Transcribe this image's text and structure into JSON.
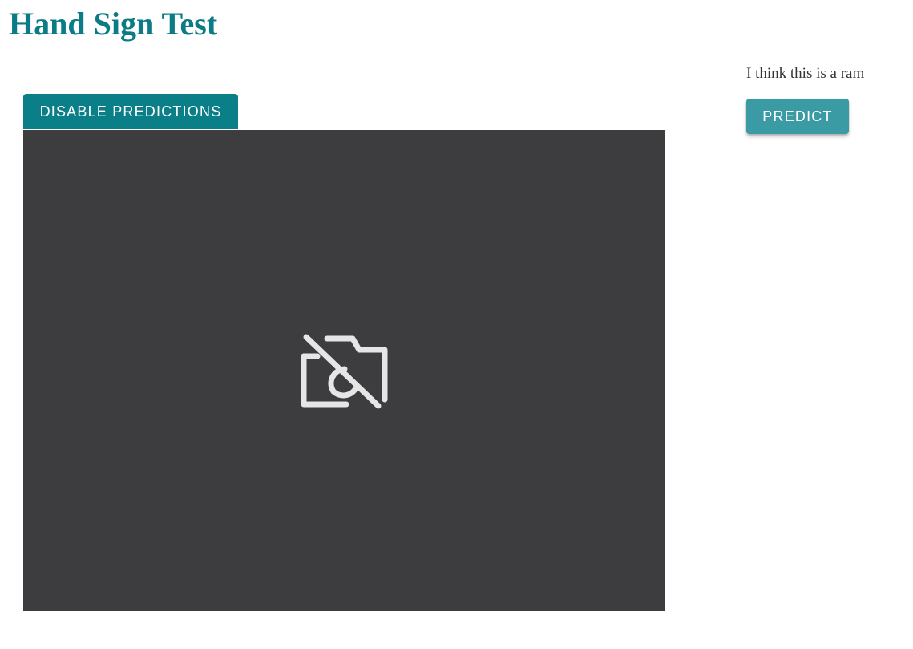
{
  "page": {
    "title": "Hand Sign Test"
  },
  "controls": {
    "disable_label": "DISABLE PREDICTIONS",
    "predict_label": "PREDICT"
  },
  "prediction": {
    "text": "I think this is a ram"
  },
  "camera": {
    "state_icon": "camera-off-icon"
  },
  "colors": {
    "title": "#0b7b86",
    "disable_button": "#0b7f88",
    "predict_button": "#3a9ba4",
    "camera_background": "#3d3d3f",
    "icon": "#e6e6e6"
  }
}
